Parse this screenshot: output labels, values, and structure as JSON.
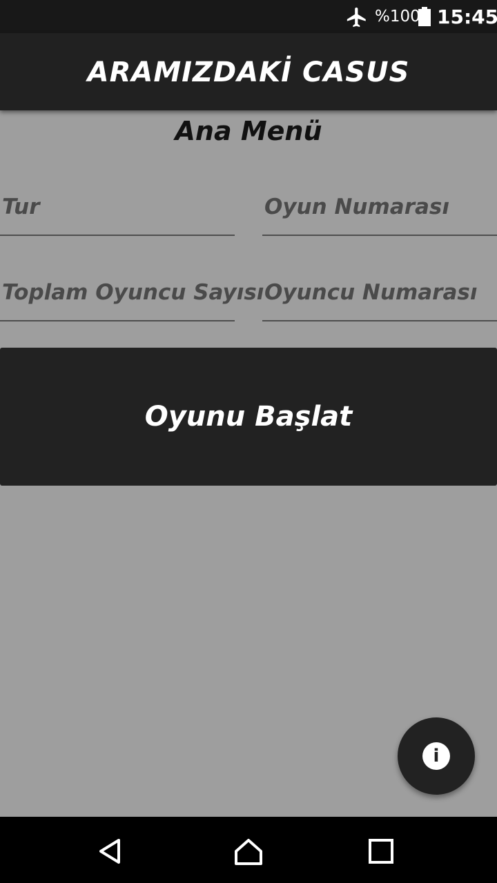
{
  "status_bar": {
    "battery_percent": "%100",
    "time": "15:45",
    "icons": [
      "airplane-mode-icon",
      "battery-full-icon"
    ]
  },
  "app_bar": {
    "title": "ARAMIZDAKİ CASUS"
  },
  "main": {
    "title": "Ana Menü",
    "fields": {
      "tur": {
        "placeholder": "Tur"
      },
      "oyun_numarasi": {
        "placeholder": "Oyun Numarası"
      },
      "toplam_oyuncu_sayisi": {
        "placeholder": "Toplam Oyuncu Sayısı"
      },
      "oyuncu_numarasi": {
        "placeholder": "Oyuncu Numarası"
      }
    },
    "start_button": {
      "label": "Oyunu Başlat"
    }
  },
  "fab": {
    "icon": "info-icon",
    "glyph": "i"
  },
  "nav_bar": {
    "icons": [
      "back-icon",
      "home-icon",
      "recent-apps-icon"
    ]
  },
  "colors": {
    "background": "#9e9e9e",
    "app_bar": "#212121",
    "button": "#222222",
    "status_bar": "#181818"
  }
}
